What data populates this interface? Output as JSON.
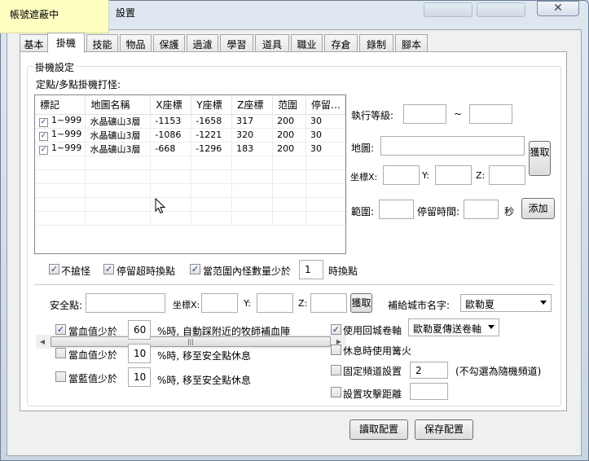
{
  "window": {
    "title": "設置",
    "overlay_banner": "帳號遮蔽中",
    "ghost_button_1": "",
    "ghost_button_2": "",
    "close_glyph": "✕"
  },
  "tabs": [
    "基本",
    "掛機",
    "技能",
    "物品",
    "保護",
    "過濾",
    "學習",
    "道具",
    "職业",
    "存倉",
    "錄制",
    "腳本"
  ],
  "active_tab": "掛機",
  "hang": {
    "group_title": "掛機設定",
    "list_caption": "定點/多點掛機打怪:",
    "columns": [
      "標記",
      "地圖名稱",
      "X座標",
      "Y座標",
      "Z座標",
      "范圍",
      "停留…"
    ],
    "rows": [
      {
        "checked": true,
        "mark": "1~999",
        "map": "水晶礦山3層",
        "x": "-1153",
        "y": "-1658",
        "z": "317",
        "range": "200",
        "stay": "30"
      },
      {
        "checked": true,
        "mark": "1~999",
        "map": "水晶礦山3層",
        "x": "-1086",
        "y": "-1221",
        "z": "320",
        "range": "200",
        "stay": "30"
      },
      {
        "checked": true,
        "mark": "1~999",
        "map": "水晶礦山3層",
        "x": "-668",
        "y": "-1296",
        "z": "183",
        "range": "200",
        "stay": "30"
      }
    ],
    "scroll_grip": "|||",
    "scroll_left": "◀",
    "scroll_right": "▶",
    "level_label": "執行等級:",
    "level_from": "",
    "level_sep": "~",
    "level_to": "",
    "map_label": "地圖:",
    "map_value": "",
    "fetch_label": "獲取",
    "coord_x_label": "坐標X:",
    "coord_y_label": "Y:",
    "coord_z_label": "Z:",
    "x_value": "",
    "y_value": "",
    "z_value": "",
    "range_label": "範圍:",
    "range_value": "",
    "stay_label": "停留時間:",
    "stay_value": "",
    "stay_unit": "秒",
    "add_label": "添加",
    "opt_no_grab": "不搶怪",
    "opt_no_grab_checked": true,
    "opt_timeout": "停留超時換點",
    "opt_timeout_checked": true,
    "opt_few_monsters": "當范圍內怪數量少於",
    "opt_few_monsters_checked": true,
    "few_monsters_value": "1",
    "few_monsters_suffix": "時換點"
  },
  "safety": {
    "safe_point_label": "安全點:",
    "safe_point_value": "",
    "coord_x_label": "坐標X:",
    "coord_y_label": "Y:",
    "coord_z_label": "Z:",
    "x_value": "",
    "y_value": "",
    "z_value": "",
    "fetch_label": "獲取",
    "supply_city_label": "補給城市名字:",
    "supply_city_value": "歐勒夏",
    "hp1_label": "當血值少於",
    "hp1_checked": true,
    "hp1_value": "60",
    "hp1_suffix": "%時, 自動踩附近的牧師補血陣",
    "hp2_label": "當血值少於",
    "hp2_checked": false,
    "hp2_value": "10",
    "hp2_suffix": "%時, 移至安全點休息",
    "mp_label": "當藍值少於",
    "mp_checked": false,
    "mp_value": "10",
    "mp_suffix": "%時, 移至安全點休息",
    "return_scroll_label": "使用回城卷軸",
    "return_scroll_checked": true,
    "return_scroll_value": "歐勒夏傳送卷軸",
    "campfire_label": "休息時使用篝火",
    "campfire_checked": false,
    "channel_label": "固定頻道設置",
    "channel_checked": false,
    "channel_value": "2",
    "channel_note": "(不勾選為隨機頻道)",
    "attack_range_label": "設置攻擊距離",
    "attack_range_checked": false,
    "attack_range_value": ""
  },
  "footer": {
    "read_label": "讀取配置",
    "save_label": "保存配置"
  }
}
